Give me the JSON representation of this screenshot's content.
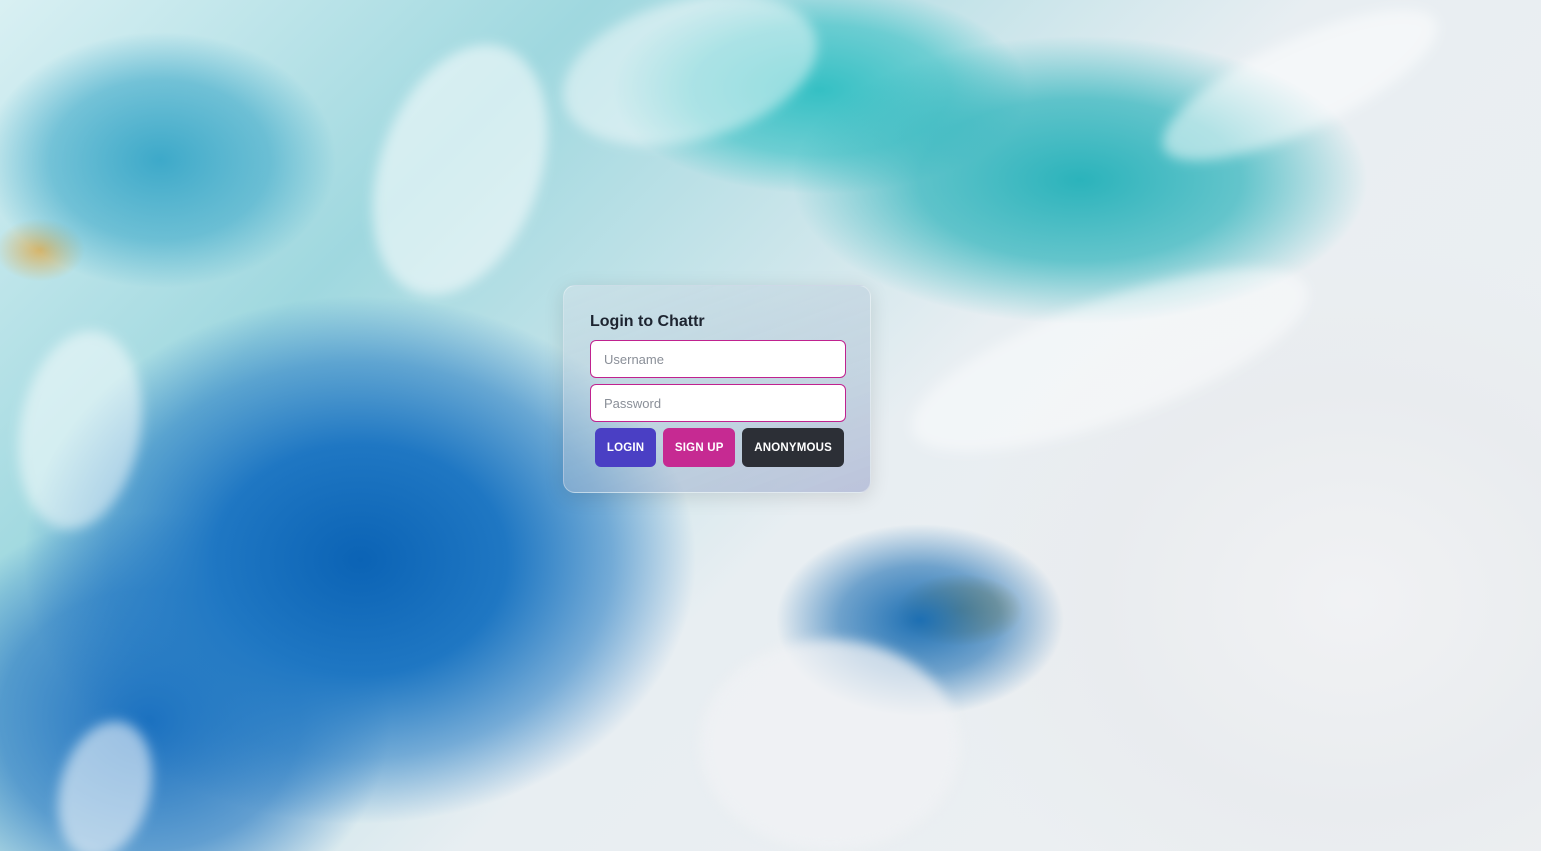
{
  "login": {
    "title": "Login to Chattr",
    "username_placeholder": "Username",
    "password_placeholder": "Password",
    "login_label": "LOGIN",
    "signup_label": "SIGN UP",
    "anonymous_label": "ANONYMOUS"
  },
  "colors": {
    "login_button": "#4a3fc4",
    "signup_button": "#c62a92",
    "anonymous_button": "#2c2f36",
    "input_border": "#c0228f"
  }
}
